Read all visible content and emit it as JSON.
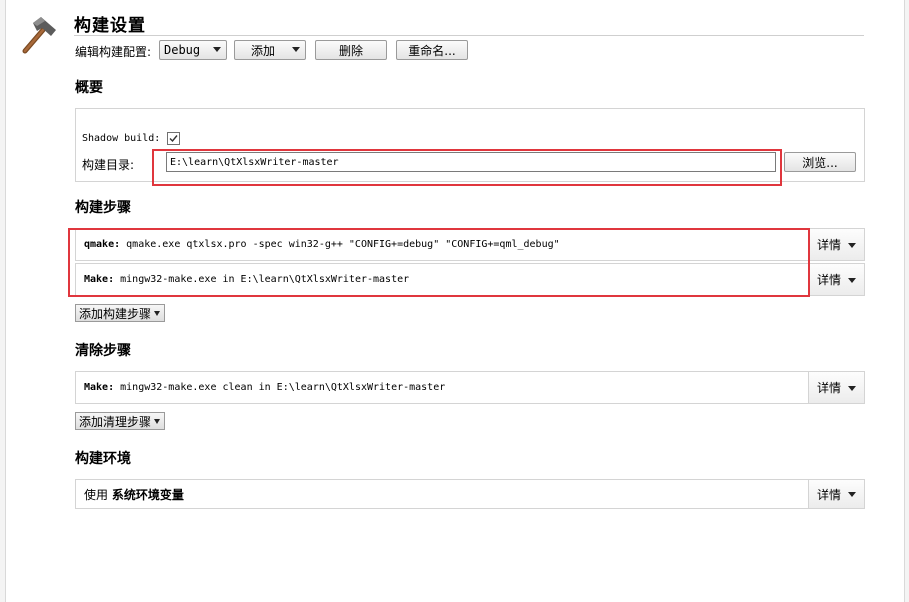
{
  "header": {
    "title": "构建设置",
    "config_label": "编辑构建配置:",
    "config_value": "Debug",
    "add_label": "添加",
    "delete_label": "删除",
    "rename_label": "重命名..."
  },
  "overview": {
    "section_title": "概要",
    "shadow_build_label": "Shadow build:",
    "shadow_build_checked": true,
    "build_dir_label": "构建目录:",
    "build_dir_value": "E:\\learn\\QtXlsxWriter-master",
    "browse_label": "浏览..."
  },
  "build_steps": {
    "section_title": "构建步骤",
    "steps": [
      {
        "name": "qmake:",
        "command": "qmake.exe qtxlsx.pro -spec win32-g++ \"CONFIG+=debug\" \"CONFIG+=qml_debug\"",
        "details_label": "详情"
      },
      {
        "name": "Make:",
        "command": "mingw32-make.exe in E:\\learn\\QtXlsxWriter-master",
        "details_label": "详情"
      }
    ],
    "add_step_label": "添加构建步骤"
  },
  "clean_steps": {
    "section_title": "清除步骤",
    "steps": [
      {
        "name": "Make:",
        "command": "mingw32-make.exe clean in E:\\learn\\QtXlsxWriter-master",
        "details_label": "详情"
      }
    ],
    "add_step_label": "添加清理步骤"
  },
  "build_env": {
    "section_title": "构建环境",
    "use_label": "使用",
    "env_value": "系统环境变量",
    "details_label": "详情"
  },
  "colors": {
    "highlight": "#e0363d"
  },
  "icons": {
    "header_icon": "hammer-icon"
  }
}
